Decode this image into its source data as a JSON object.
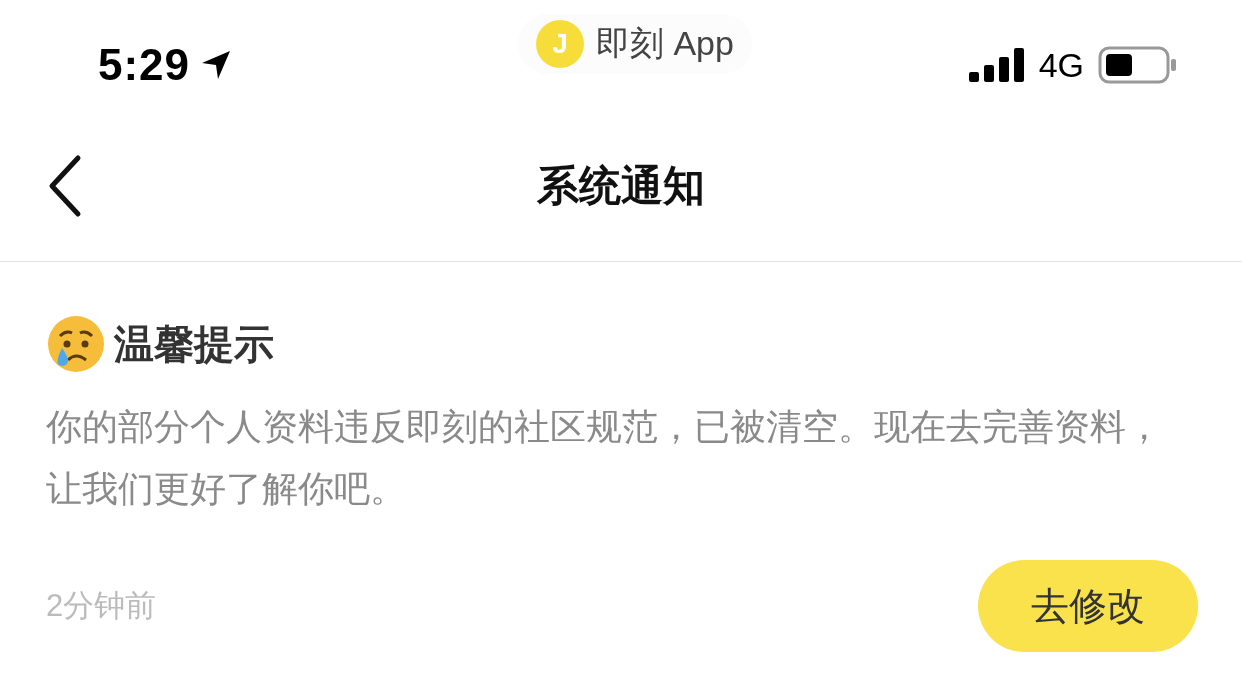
{
  "status_bar": {
    "time": "5:29",
    "app_logo": "J",
    "app_name": "即刻 App",
    "network": "4G"
  },
  "nav_bar": {
    "title": "系统通知"
  },
  "notice": {
    "title": "温馨提示",
    "body": "你的部分个人资料违反即刻的社区规范，已被清空。现在去完善资料，让我们更好了解你吧。",
    "time": "2分钟前",
    "action": "去修改"
  }
}
